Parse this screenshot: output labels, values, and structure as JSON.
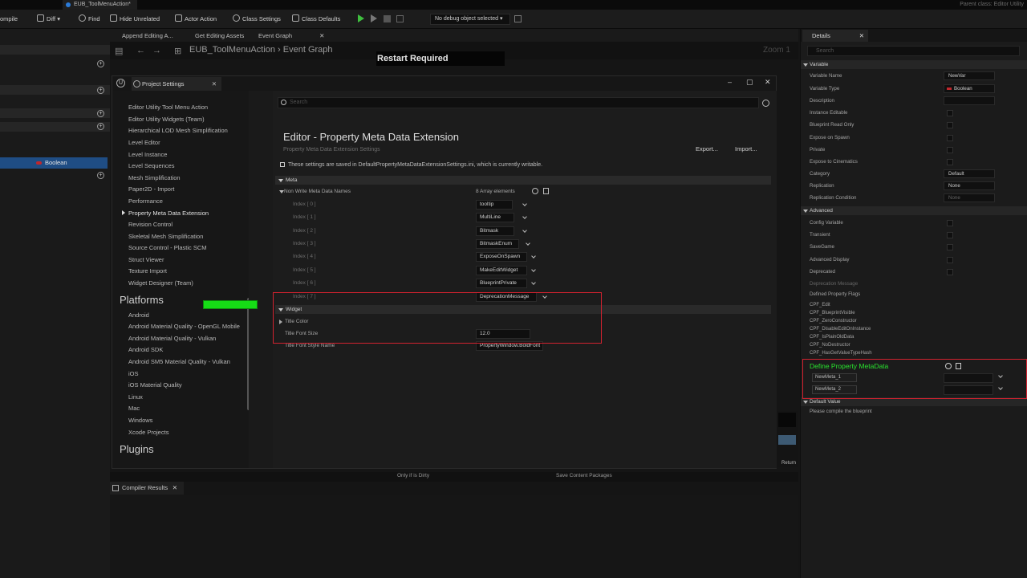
{
  "titlebar": {
    "tab_label": "EUB_ToolMenuAction*",
    "right_text": "Parent class:  Editor Utility"
  },
  "toolbar": {
    "items": [
      "ompile",
      "Diff ▾",
      "Find",
      "Hide Unrelated",
      "Actor Action",
      "Class Settings",
      "Class Defaults"
    ],
    "debug_select": "No debug object selected"
  },
  "editor": {
    "tabs": [
      "Append Editing A...",
      "Get Editing Assets",
      "Event Graph"
    ],
    "breadcrumb": "EUB_ToolMenuAction  ›  Event Graph",
    "restart": "Restart Required",
    "zoom": "Zoom 1"
  },
  "left_panel": {
    "selected_var": "Boolean"
  },
  "project_settings": {
    "tab_label": "Project Settings",
    "search_placeholder": "Search",
    "title": "Editor - Property Meta Data Extension",
    "subtitle": "Property Meta Data Extension Settings",
    "export_label": "Export...",
    "import_label": "Import...",
    "note": "These settings are saved in DefaultPropertyMetaDataExtensionSettings.ini, which is currently writable.",
    "nav_items": [
      "Editor Utility Tool Menu Action",
      "Editor Utility Widgets (Team)",
      "Hierarchical LOD Mesh Simplification",
      "Level Editor",
      "Level Instance",
      "Level Sequences",
      "Mesh Simplification",
      "Paper2D - Import",
      "Performance",
      "Property Meta Data Extension",
      "Revision Control",
      "Skeletal Mesh Simplification",
      "Source Control - Plastic SCM",
      "Struct Viewer",
      "Texture Import",
      "Widget Designer (Team)"
    ],
    "platforms_heading": "Platforms",
    "platforms": [
      "Android",
      "Android Material Quality - OpenGL Mobile",
      "Android Material Quality - Vulkan",
      "Android SDK",
      "Android SM5 Material Quality - Vulkan",
      "iOS",
      "iOS Material Quality",
      "Linux",
      "Mac",
      "Windows",
      "Xcode Projects"
    ],
    "plugins_heading": "Plugins",
    "meta_section": "Meta",
    "non_write_label": "Non Write Meta Data Names",
    "array_count": "8 Array elements",
    "meta_names": [
      {
        "index": "Index [ 0 ]",
        "value": "tooltip"
      },
      {
        "index": "Index [ 1 ]",
        "value": "MultiLine"
      },
      {
        "index": "Index [ 2 ]",
        "value": "Bitmask"
      },
      {
        "index": "Index [ 3 ]",
        "value": "BitmaskEnum"
      },
      {
        "index": "Index [ 4 ]",
        "value": "ExposeOnSpawn"
      },
      {
        "index": "Index [ 5 ]",
        "value": "MakeEditWidget"
      },
      {
        "index": "Index [ 6 ]",
        "value": "BlueprintPrivate"
      },
      {
        "index": "Index [ 7 ]",
        "value": "DeprecationMessage"
      }
    ],
    "widget_section": "Widget",
    "title_color_label": "Title Color",
    "title_color": "#16dc16",
    "font_size_label": "Title Font Size",
    "font_size_value": "12.0",
    "font_style_label": "Title Font Style Name",
    "font_style_value": "PropertyWindow.BoldFont"
  },
  "details": {
    "tab_label": "Details",
    "search_placeholder": "Search",
    "variable_section": "Variable",
    "variable_name_label": "Variable Name",
    "variable_name_value": "NewVar",
    "variable_type_label": "Variable Type",
    "variable_type_value": "Boolean",
    "rows": [
      "Description",
      "Instance Editable",
      "Blueprint Read Only",
      "Expose on Spawn",
      "Private",
      "Expose to Cinematics"
    ],
    "category_label": "Category",
    "category_value": "Default",
    "replication_label": "Replication",
    "replication_value": "None",
    "rep_cond_label": "Replication Condition",
    "rep_cond_value": "None",
    "advanced_section": "Advanced",
    "advanced_rows": [
      "Config Variable",
      "Transient",
      "SaveGame",
      "Advanced Display",
      "Deprecated",
      "Deprecation Message"
    ],
    "flags_label": "Defined Property Flags",
    "flags": [
      "CPF_Edit",
      "CPF_BlueprintVisible",
      "CPF_ZeroConstructor",
      "CPF_DisableEditOnInstance",
      "CPF_IsPlainOldData",
      "CPF_NoDestructor",
      "CPF_HasGetValueTypeHash"
    ],
    "define_title": "Define Property MetaData",
    "meta_items": [
      "NewMeta_1",
      "NewMeta_2"
    ],
    "default_section": "Default Value",
    "default_note": "Please compile the blueprint"
  },
  "bottom": {
    "only_dirty": "Only if is Dirty",
    "save_packages": "Save Content Packages",
    "compiler_tab": "Compiler Results",
    "return_label": "Return"
  },
  "colors": {
    "accent_green": "#29e52e",
    "highlight_red": "#d2222f",
    "selection_blue": "#1f4d84"
  }
}
